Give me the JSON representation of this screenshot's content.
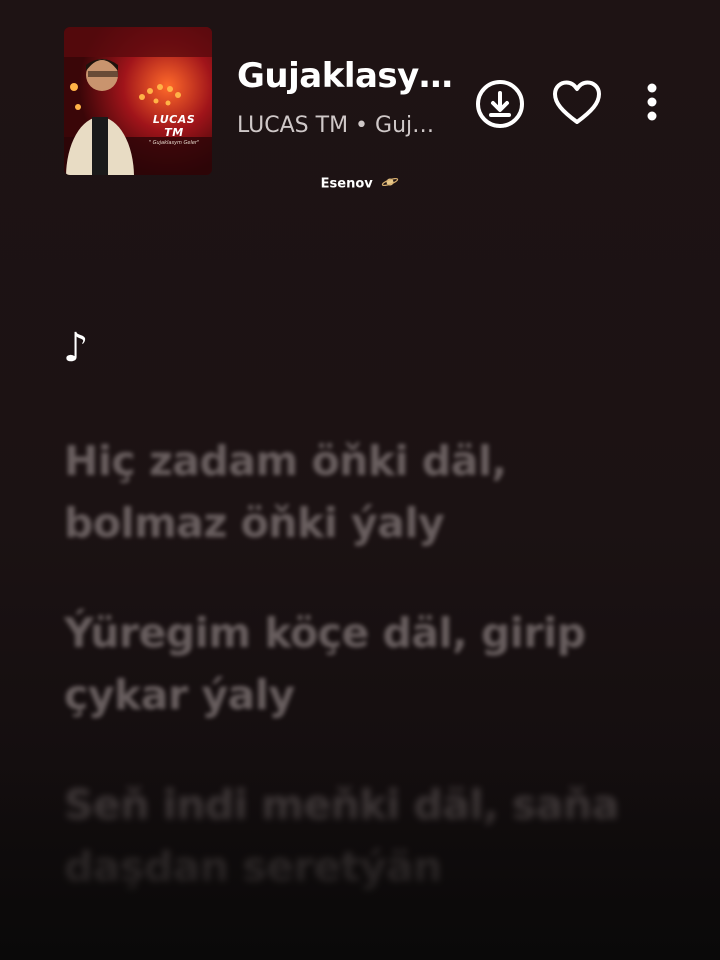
{
  "album": {
    "artist_text": "LUCAS TM",
    "subtitle_text": "\" Gujaklasym Geler\""
  },
  "track": {
    "title": "Gujaklasy…",
    "subtitle": "LUCAS TM • Guj…"
  },
  "icons": {
    "download": "download-icon",
    "like": "heart-icon",
    "more": "more-vertical-icon",
    "planet": "planet-icon"
  },
  "overlay": {
    "label": "Esenov"
  },
  "lyrics": {
    "note": "♪",
    "lines": [
      "Hiç zadam öňki däl, bolmaz öňki ýaly",
      "Ýüregim köçe däl, girip çykar ýaly",
      "Seň indi meňki däl, saňa daşdan seretýän"
    ]
  },
  "colors": {
    "background": "#1b1213",
    "lyric_dim": "#8a7f7f",
    "text_primary": "#ffffff",
    "text_secondary": "#cfc8c8"
  }
}
